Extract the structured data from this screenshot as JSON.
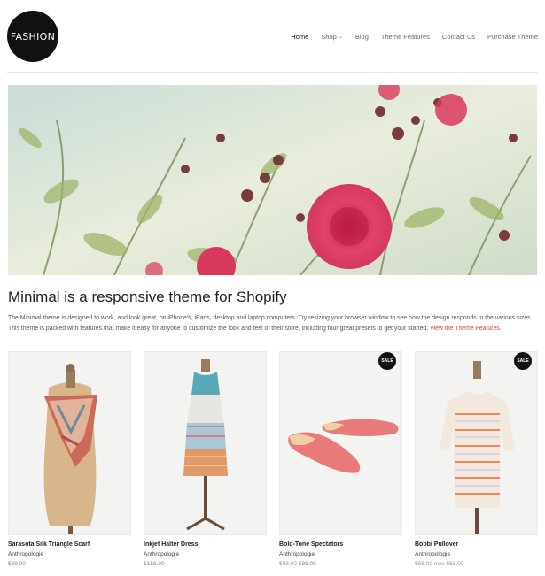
{
  "logo": {
    "text": "FASHION"
  },
  "nav": {
    "items": [
      {
        "label": "Home",
        "active": true
      },
      {
        "label": "Shop",
        "dropdown": true
      },
      {
        "label": "Blog"
      },
      {
        "label": "Theme Features"
      },
      {
        "label": "Contact Us"
      },
      {
        "label": "Purchase Theme"
      }
    ]
  },
  "hero": {
    "alt": "pink roses banner"
  },
  "headline": "Minimal is a responsive theme for Shopify",
  "intro": {
    "text": "The Minimal theme is designed to work, and look great, on iPhone's, iPads, desktop and laptop computers. Try resizing your browser window to see how the design responds to the various sizes. This theme is packed with features that make it easy for anyone to customize the look and feel of their store, including four great presets to get your started.",
    "link": "View the Theme Features."
  },
  "products": [
    {
      "name": "Sarasota Silk Triangle Scarf",
      "vendor": "Anthropologie",
      "price": "$88.00",
      "compare": "",
      "sale": false
    },
    {
      "name": "Inkjet Halter Dress",
      "vendor": "Anthropologie",
      "price": "$168.00",
      "compare": "",
      "sale": false
    },
    {
      "name": "Bold-Tone Spectators",
      "vendor": "Anthropologie",
      "price": "$88.00",
      "compare": "$98.00",
      "sale": true,
      "badge": "SALE"
    },
    {
      "name": "Bobbi Pullover",
      "vendor": "Anthropologie",
      "price": "$58.00",
      "compare": "$68.00 now",
      "sale": true,
      "badge": "SALE"
    }
  ],
  "colors": {
    "accent": "#d9433b",
    "logo_bg": "#111111"
  }
}
